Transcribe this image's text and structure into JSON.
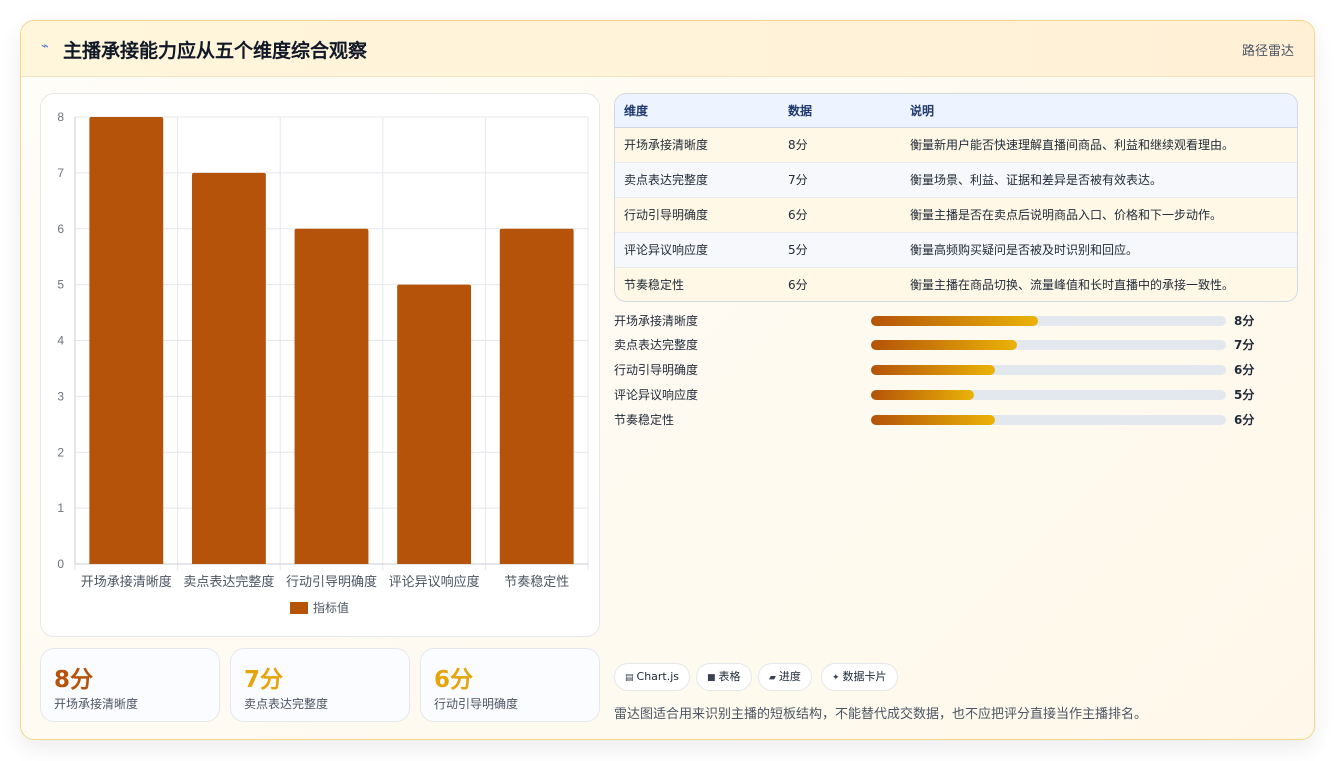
{
  "header": {
    "title": "主播承接能力应从五个维度综合观察",
    "badge": "路径雷达",
    "icon": "lightning-icon"
  },
  "chart_data": {
    "type": "bar",
    "categories": [
      "开场承接清晰度",
      "卖点表达完整度",
      "行动引导明确度",
      "评论异议响应度",
      "节奏稳定性"
    ],
    "series": [
      {
        "name": "指标值",
        "values": [
          8,
          7,
          6,
          5,
          6
        ]
      }
    ],
    "ylim": [
      0,
      8
    ],
    "yticks": [
      "0",
      "1",
      "2",
      "3",
      "4",
      "5",
      "6",
      "7",
      "8"
    ],
    "grid": true,
    "legend": "bottom",
    "color": "#b45309"
  },
  "kpis": [
    {
      "value": "8分",
      "label": "开场承接清晰度",
      "color": "#b45309"
    },
    {
      "value": "7分",
      "label": "卖点表达完整度",
      "color": "#e5a50a"
    },
    {
      "value": "6分",
      "label": "行动引导明确度",
      "color": "#e5a50a"
    }
  ],
  "table": {
    "headers": [
      "维度",
      "数据",
      "说明"
    ],
    "rows": [
      [
        "开场承接清晰度",
        "8分",
        "衡量新用户能否快速理解直播间商品、利益和继续观看理由。"
      ],
      [
        "卖点表达完整度",
        "7分",
        "衡量场景、利益、证据和差异是否被有效表达。"
      ],
      [
        "行动引导明确度",
        "6分",
        "衡量主播是否在卖点后说明商品入口、价格和下一步动作。"
      ],
      [
        "评论异议响应度",
        "5分",
        "衡量高频购买疑问是否被及时识别和回应。"
      ],
      [
        "节奏稳定性",
        "6分",
        "衡量主播在商品切换、流量峰值和长时直播中的承接一致性。"
      ]
    ]
  },
  "progress": [
    {
      "label": "开场承接清晰度",
      "value_text": "8分",
      "fraction": 0.47
    },
    {
      "label": "卖点表达完整度",
      "value_text": "7分",
      "fraction": 0.41
    },
    {
      "label": "行动引导明确度",
      "value_text": "6分",
      "fraction": 0.35
    },
    {
      "label": "评论异议响应度",
      "value_text": "5分",
      "fraction": 0.29
    },
    {
      "label": "节奏稳定性",
      "value_text": "6分",
      "fraction": 0.35
    }
  ],
  "chips": [
    {
      "icon": "chart-icon",
      "glyph": "▤",
      "label": "Chart.js"
    },
    {
      "icon": "table-icon",
      "glyph": "■",
      "label": "表格"
    },
    {
      "icon": "progress-icon",
      "glyph": "▰",
      "label": "进度"
    },
    {
      "icon": "sparkle-icon",
      "glyph": "✦",
      "label": "数据卡片"
    }
  ],
  "note": "雷达图适合用来识别主播的短板结构，不能替代成交数据，也不应把评分直接当作主播排名。"
}
